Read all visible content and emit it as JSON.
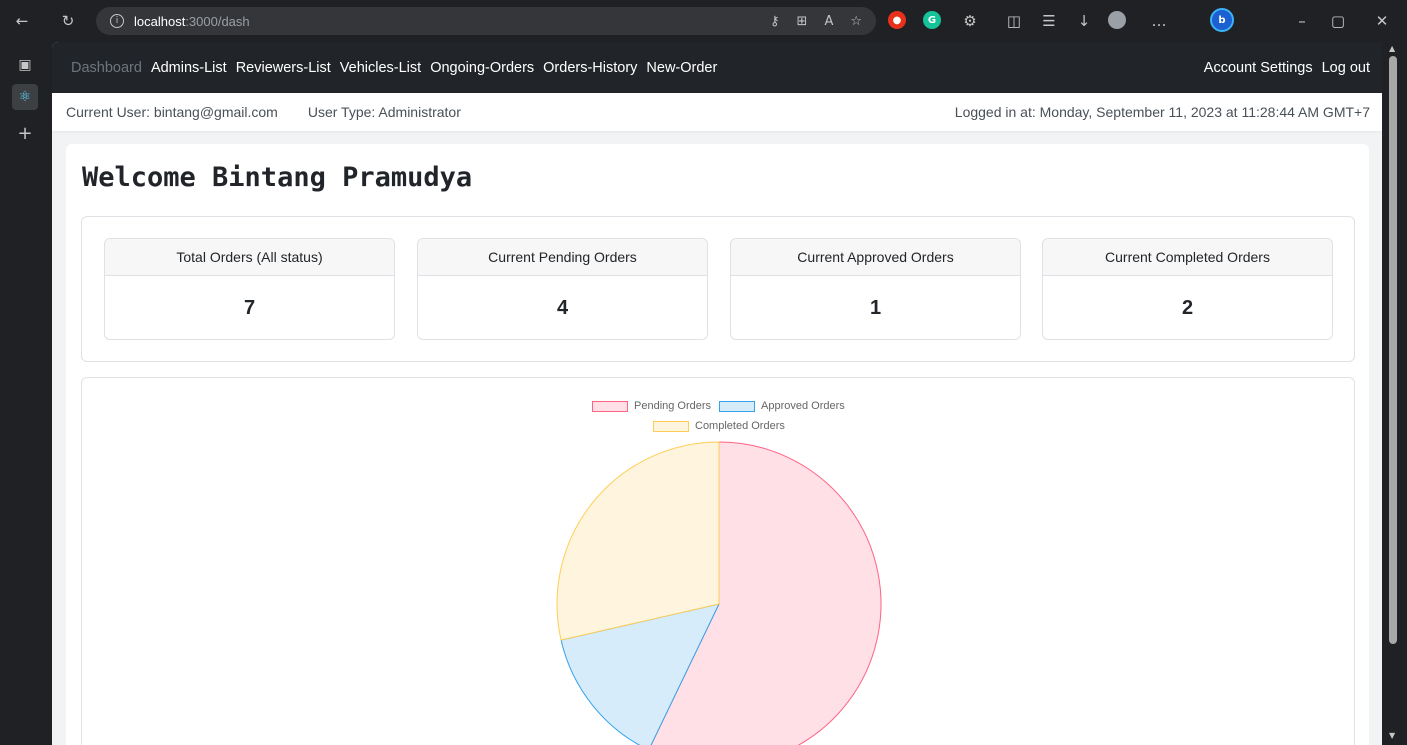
{
  "browser": {
    "url_host": "localhost",
    "url_path": ":3000/dash"
  },
  "nav": {
    "items": [
      {
        "label": "Dashboard",
        "active": true
      },
      {
        "label": "Admins-List",
        "active": false
      },
      {
        "label": "Reviewers-List",
        "active": false
      },
      {
        "label": "Vehicles-List",
        "active": false
      },
      {
        "label": "Ongoing-Orders",
        "active": false
      },
      {
        "label": "Orders-History",
        "active": false
      },
      {
        "label": "New-Order",
        "active": false
      }
    ],
    "account_settings": "Account Settings",
    "logout": "Log out"
  },
  "userbar": {
    "current_user": "Current User: bintang@gmail.com",
    "user_type": "User Type: Administrator",
    "logged_in": "Logged in at: Monday, September 11, 2023 at 11:28:44 AM GMT+7"
  },
  "welcome": "Welcome Bintang Pramudya",
  "stats": [
    {
      "label": "Total Orders (All status)",
      "value": "7"
    },
    {
      "label": "Current Pending Orders",
      "value": "4"
    },
    {
      "label": "Current Approved Orders",
      "value": "1"
    },
    {
      "label": "Current Completed Orders",
      "value": "2"
    }
  ],
  "chart_data": {
    "type": "pie",
    "categories": [
      "Pending Orders",
      "Approved Orders",
      "Completed Orders"
    ],
    "values": [
      4,
      1,
      2
    ],
    "colors": {
      "fill": [
        "#ffe0e6",
        "#d7ecfb",
        "#fff4dd"
      ],
      "stroke": [
        "#ff6384",
        "#36a2eb",
        "#ffce56"
      ]
    },
    "legend_position": "top"
  }
}
